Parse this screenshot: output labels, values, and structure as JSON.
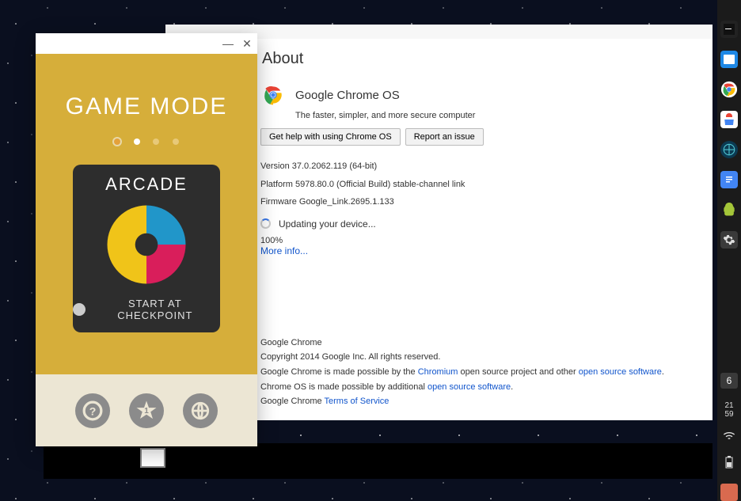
{
  "about": {
    "title": "About",
    "product": "Google Chrome OS",
    "tagline": "The faster, simpler, and more secure computer",
    "help_btn": "Get help with using Chrome OS",
    "report_btn": "Report an issue",
    "version": "Version 37.0.2062.119 (64-bit)",
    "platform": "Platform 5978.80.0 (Official Build) stable-channel link",
    "firmware": "Firmware Google_Link.2695.1.133",
    "updating": "Updating your device...",
    "percent": "100%",
    "more_info": "More info...",
    "footer_product": "Google Chrome",
    "copyright": "Copyright 2014 Google Inc. All rights reserved.",
    "made1_pre": "Google Chrome is made possible by the ",
    "made1_link": "Chromium",
    "made1_post": " open source project and other ",
    "made1_link2": "open source software",
    "made2_pre": "Chrome OS is made possible by additional ",
    "made2_link": "open source software",
    "tos_pre": "Google Chrome ",
    "tos_link": "Terms of Service"
  },
  "game": {
    "title": "GAME MODE",
    "arcade": "ARCADE",
    "checkpoint": "START AT CHECKPOINT",
    "star_value": "1"
  },
  "dock": {
    "notif_count": "6",
    "hour": "21",
    "minute": "59"
  }
}
